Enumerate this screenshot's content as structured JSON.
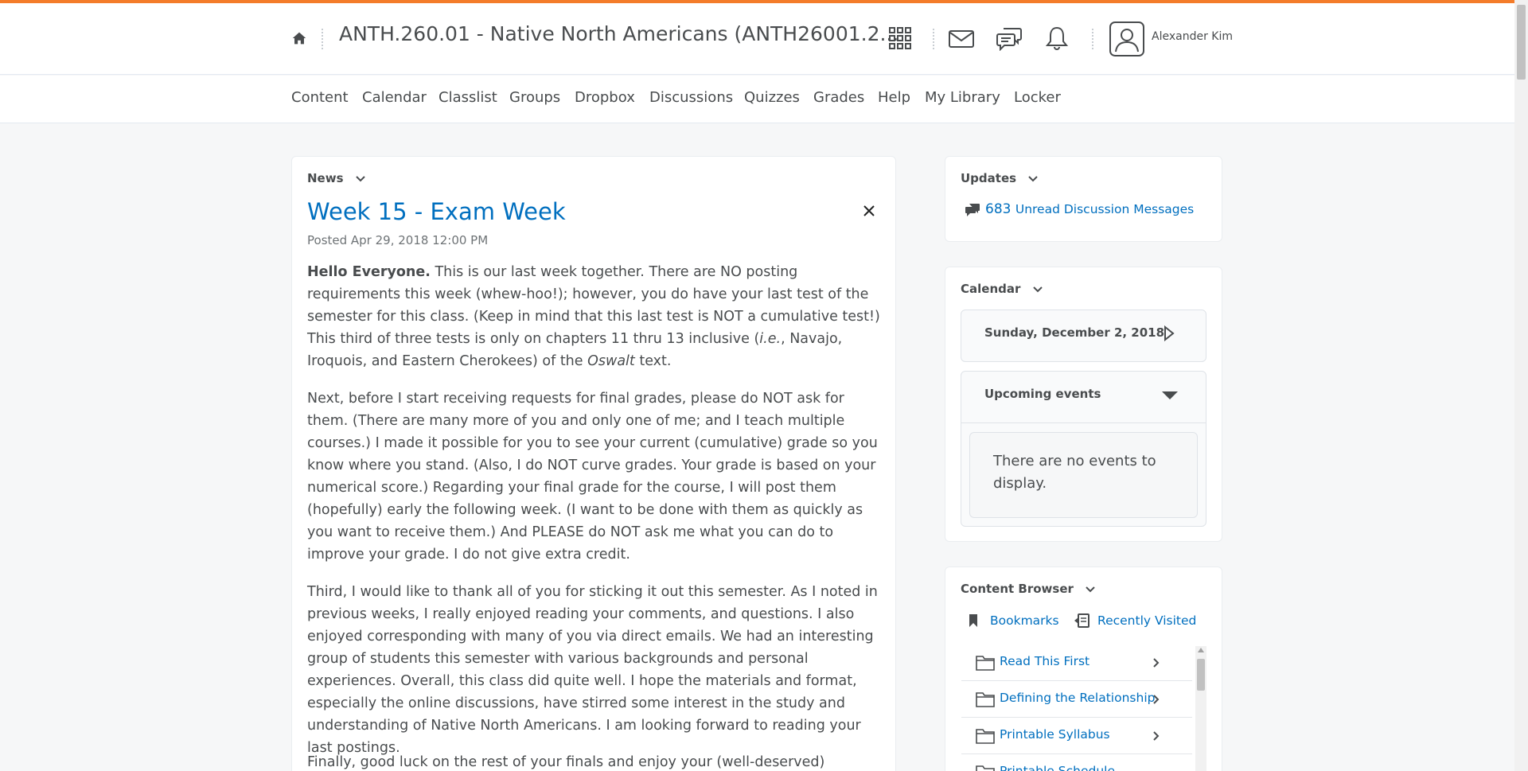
{
  "header": {
    "course_title": "ANTH.260.01 - Native North Americans (ANTH26001.2...",
    "user_name": "Alexander Kim"
  },
  "nav": {
    "items": [
      "Content",
      "Calendar",
      "Classlist",
      "Groups",
      "Dropbox",
      "Discussions",
      "Quizzes",
      "Grades",
      "Help",
      "My Library",
      "Locker"
    ]
  },
  "news": {
    "widget_title": "News",
    "title": "Week 15 - Exam Week",
    "posted": "Posted Apr 29, 2018 12:00 PM",
    "p1_bold": "Hello Everyone.",
    "p1_a": " This is our last week together. There are NO posting requirements this week (whew-hoo!); however, you do have your last test of the semester for this class.  (Keep in mind that this last test is NOT a cumulative test!)  This third of three tests is only on chapters 11 thru 13 inclusive (",
    "p1_ie": "i.e.",
    "p1_b": ", Navajo, Iroquois, and Eastern Cherokees) of the ",
    "p1_oswalt": "Oswalt",
    "p1_c": " text.",
    "p2": "Next, before I start receiving requests for final grades, please do NOT ask for them. (There are many more of you and only one of me; and I teach multiple courses.)  I made it possible for you to see your current (cumulative) grade so you know where you stand.  (Also, I do NOT curve grades. Your grade is based on your numerical score.) Regarding your final grade for the course, I will post them (hopefully) early the following week.  (I want to be done with them as quickly as you want to receive them.) And PLEASE do NOT ask me what you can do to improve your grade. I do not give extra credit.",
    "p3": "Third, I would like to thank all of you for sticking it out this semester.  As I noted in previous weeks, I really enjoyed reading your comments, and questions. I also enjoyed corresponding with many of you via direct emails. We had an interesting group of students this semester with various backgrounds and personal experiences. Overall, this class did quite well. I hope the materials and format, especially the online discussions, have stirred some interest in the study and understanding of Native North Americans. I am looking forward to reading your last postings.",
    "p4": "Finally, good luck on the rest of your finals and enjoy your (well-deserved) semester"
  },
  "updates": {
    "widget_title": "Updates",
    "count": "683",
    "label": "Unread Discussion Messages"
  },
  "calendar": {
    "widget_title": "Calendar",
    "date": "Sunday, December 2, 2018",
    "upcoming_label": "Upcoming events",
    "no_events": "There are no events to display."
  },
  "content_browser": {
    "widget_title": "Content Browser",
    "bookmarks": "Bookmarks",
    "recently_visited": "Recently Visited",
    "items": [
      "Read This First",
      "Defining the Relationship",
      "Printable Syllabus",
      "Printable Schedule"
    ]
  },
  "colors": {
    "accent_bar": "#f47c2a",
    "link": "#006fbf"
  }
}
